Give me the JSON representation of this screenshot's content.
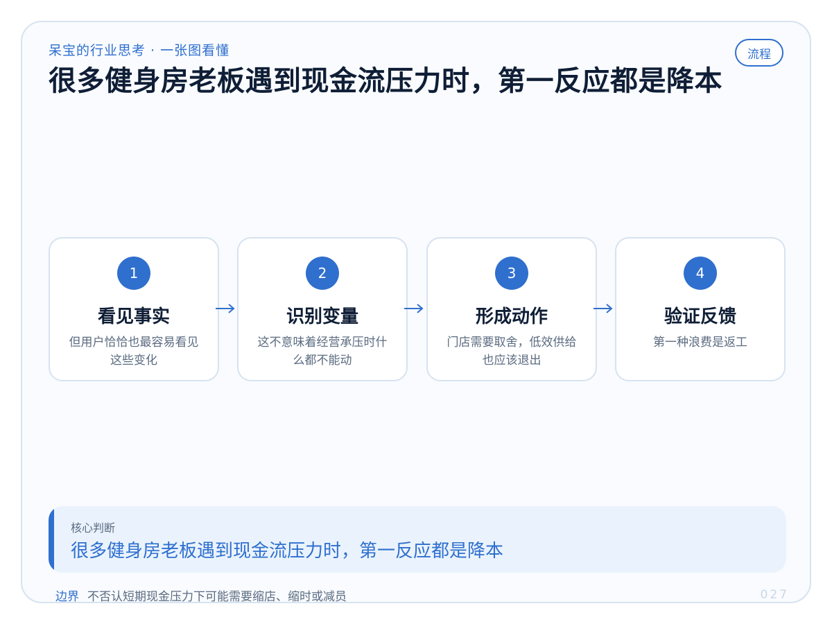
{
  "header": {
    "subtitle": "呆宝的行业思考 · 一张图看懂",
    "tag": "流程",
    "title": "很多健身房老板遇到现金流压力时，第一反应都是降本"
  },
  "steps": [
    {
      "number": "1",
      "title": "看见事实",
      "description": "但用户恰恰也最容易看见这些变化"
    },
    {
      "number": "2",
      "title": "识别变量",
      "description": "这不意味着经营承压时什么都不能动"
    },
    {
      "number": "3",
      "title": "形成动作",
      "description": "门店需要取舍，低效供给也应该退出"
    },
    {
      "number": "4",
      "title": "验证反馈",
      "description": "第一种浪费是返工"
    }
  ],
  "core": {
    "label": "核心判断",
    "text": "很多健身房老板遇到现金流压力时，第一反应都是降本"
  },
  "footer": {
    "label": "边界",
    "text": "不否认短期现金压力下可能需要缩店、缩时或减员"
  },
  "page_number": "027",
  "colors": {
    "accent": "#2f6fce",
    "border": "#d6e3f0",
    "title": "#0f1e36",
    "muted": "#5b6b80",
    "panel": "#eaf3fd"
  }
}
